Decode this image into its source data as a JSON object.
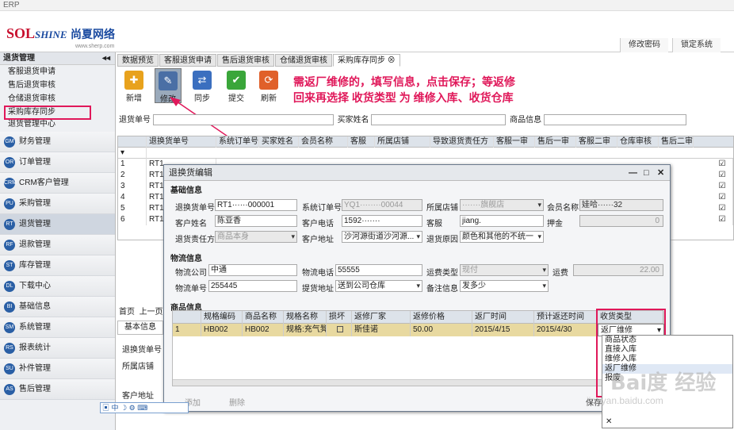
{
  "window_title": "ERP",
  "logo": {
    "brand": "SHINE",
    "brand_prefix": "SOL",
    "cn": "尚夏网络",
    "sub": "www.sherp.com"
  },
  "header_buttons": [
    "修改密码",
    "锁定系统"
  ],
  "sidebar": {
    "title": "退货管理",
    "subitems": [
      "客服退货申请",
      "售后退货审核",
      "仓储退货审核",
      "采购库存同步",
      "退货管理中心"
    ],
    "modules": [
      {
        "icon": "GM",
        "label": "财务管理"
      },
      {
        "icon": "OR",
        "label": "订单管理"
      },
      {
        "icon": "CRM",
        "label": "CRM客户管理"
      },
      {
        "icon": "PU",
        "label": "采购管理"
      },
      {
        "icon": "RT",
        "label": "退货管理"
      },
      {
        "icon": "RF",
        "label": "退款管理"
      },
      {
        "icon": "ST",
        "label": "库存管理"
      },
      {
        "icon": "DL",
        "label": "下载中心"
      },
      {
        "icon": "BI",
        "label": "基础信息"
      },
      {
        "icon": "SM",
        "label": "系统管理"
      },
      {
        "icon": "RS",
        "label": "报表统计"
      },
      {
        "icon": "SU",
        "label": "补件管理"
      },
      {
        "icon": "AS",
        "label": "售后管理"
      }
    ]
  },
  "tabs": [
    "数据预览",
    "客服退货申请",
    "售后退货审核",
    "仓储退货审核",
    "采购库存同步"
  ],
  "toolbar": [
    {
      "label": "新增",
      "color": "#e8a21d",
      "icon": "add-icon"
    },
    {
      "label": "修改",
      "color": "#4a6fa5",
      "icon": "edit-icon"
    },
    {
      "label": "同步",
      "color": "#3b6fbf",
      "icon": "sync-icon"
    },
    {
      "label": "提交",
      "color": "#3aa63a",
      "icon": "submit-icon"
    },
    {
      "label": "刷新",
      "color": "#e0602a",
      "icon": "refresh-icon"
    }
  ],
  "annotation": {
    "line1": "需返厂维修的，填写信息，点击保存；等返修",
    "line2": "回来再选择 收货类型 为 维修入库、收货仓库"
  },
  "search": {
    "return_no_label": "退货单号",
    "buyer_label": "买家姓名",
    "product_label": "商品信息"
  },
  "grid": {
    "headers": [
      "退换货单号",
      "系统订单号",
      "买家姓名",
      "会员名称",
      "客服",
      "所属店铺",
      "导致退货责任方",
      "客服一审",
      "售后一审",
      "客服二审",
      "仓库审核",
      "售后二审"
    ],
    "rows": [
      "RT1",
      "RT1",
      "RT1",
      "RT1",
      "RT1",
      "RT1"
    ],
    "row_nums": [
      "1",
      "2",
      "3",
      "4",
      "5",
      "6"
    ]
  },
  "lower": {
    "pager": "首页",
    "prev": "上一页",
    "tab": "基本信息",
    "f1": "退换货单号",
    "f2": "所属店铺",
    "f3": "客户地址"
  },
  "dialog": {
    "title": "退换货编辑",
    "basic_title": "基础信息",
    "return_no_label": "退换货单号",
    "return_no": "RT1······000001",
    "order_no_label": "系统订单号",
    "order_no": "YQ1········00044",
    "shop_label": "所属店铺",
    "shop": "·······旗舰店",
    "member_label": "会员名称",
    "member": "娃哈······32",
    "customer_label": "客户姓名",
    "customer": "陈亚香",
    "phone_label": "客户电话",
    "phone": "1592·······",
    "service_label": "客服",
    "service": "jiang.",
    "deposit_label": "押金",
    "deposit": "0",
    "resp_label": "退货责任方",
    "resp": "商品本身",
    "address_label": "客户地址",
    "address": "沙河源街道沙河源...",
    "reason_label": "退货原因",
    "reason": "颜色和其他的不统一",
    "logistics_title": "物流信息",
    "lcompany_label": "物流公司",
    "lcompany": "中通",
    "lphone_label": "物流电话",
    "lphone": "55555",
    "ftype_label": "运费类型",
    "ftype": "现付",
    "freight_label": "运费",
    "freight": "22.00",
    "lno_label": "物流单号",
    "lno": "255445",
    "pickup_label": "提货地址",
    "pickup": "送到公司仓库",
    "remark_label": "备注信息",
    "remark": "发多少",
    "products_title": "商品信息",
    "pheaders": [
      "规格编码",
      "商品名称",
      "规格名称",
      "损坏",
      "返修厂家",
      "返修价格",
      "返厂时间",
      "预计返还时间",
      "收货类型"
    ],
    "prow": {
      "num": "1",
      "code": "HB002",
      "name": "HB002",
      "spec": "规格:充气凳",
      "vendor": "斯佳诺",
      "price": "50.00",
      "out_date": "2015/4/15",
      "back_date": "2015/4/30",
      "rtype": "返厂维修"
    },
    "add_btn": "添加",
    "del_btn": "删除",
    "save_btn": "保存"
  },
  "dropdown": {
    "options": [
      "商品状态",
      "直接入库",
      "维修入库",
      "返厂维修",
      "报废"
    ]
  },
  "ime": "中",
  "watermark": {
    "main": "Bai度 经验",
    "sub": "jingyan.baidu.com"
  }
}
